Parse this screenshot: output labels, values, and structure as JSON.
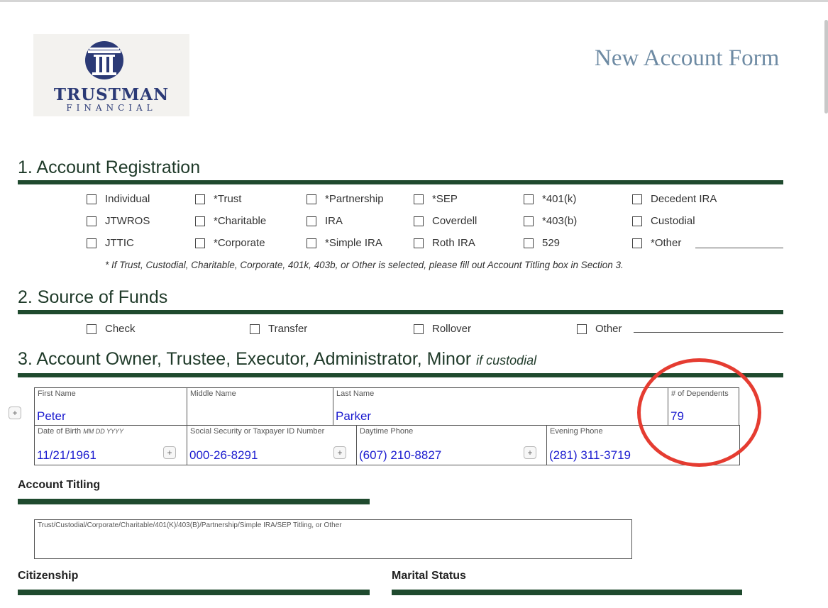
{
  "logo": {
    "brand": "TRUSTMAN",
    "sub": "FINANCIAL"
  },
  "form_title": "New Account Form",
  "section1": {
    "title": "1. Account Registration",
    "options": [
      [
        "Individual",
        "*Trust",
        "*Partnership",
        "*SEP",
        "*401(k)",
        "Decedent IRA"
      ],
      [
        "JTWROS",
        "*Charitable",
        "IRA",
        "Coverdell",
        "*403(b)",
        "Custodial"
      ],
      [
        "JTTIC",
        "*Corporate",
        "*Simple IRA",
        "Roth IRA",
        "529",
        "*Other"
      ]
    ],
    "note": "* If Trust, Custodial, Charitable, Corporate, 401k, 403b, or Other is selected, please fill out Account Titling box in Section 3."
  },
  "section2": {
    "title": "2. Source of Funds",
    "options": [
      "Check",
      "Transfer",
      "Rollover",
      "Other"
    ]
  },
  "section3": {
    "title": "3. Account Owner, Trustee, Executor, Administrator, Minor",
    "title_suffix": "if custodial",
    "fields": {
      "first_name": {
        "label": "First Name",
        "value": "Peter"
      },
      "middle_name": {
        "label": "Middle Name",
        "value": ""
      },
      "last_name": {
        "label": "Last Name",
        "value": "Parker"
      },
      "dependents": {
        "label": "# of Dependents",
        "value": "79"
      },
      "dob": {
        "label": "Date of Birth",
        "label_hint": "MM DD YYYY",
        "value": "11/21/1961"
      },
      "ssn": {
        "label": "Social Security or Taxpayer ID Number",
        "value": "000-26-8291"
      },
      "day_phone": {
        "label": "Daytime Phone",
        "value": "(607) 210-8827"
      },
      "eve_phone": {
        "label": "Evening Phone",
        "value": "(281) 311-3719"
      }
    },
    "plus_label": "+"
  },
  "account_titling": {
    "title": "Account Titling",
    "box_label": "Trust/Custodial/Corporate/Charitable/401(K)/403(B)/Partnership/Simple IRA/SEP Titling, or Other"
  },
  "citizenship": {
    "title": "Citizenship"
  },
  "marital_status": {
    "title": "Marital Status"
  },
  "colors": {
    "accent_green": "#1f4a2e",
    "value_blue": "#1a1acf",
    "annotation_red": "#e53c31",
    "title_blue": "#6d8aa3"
  }
}
